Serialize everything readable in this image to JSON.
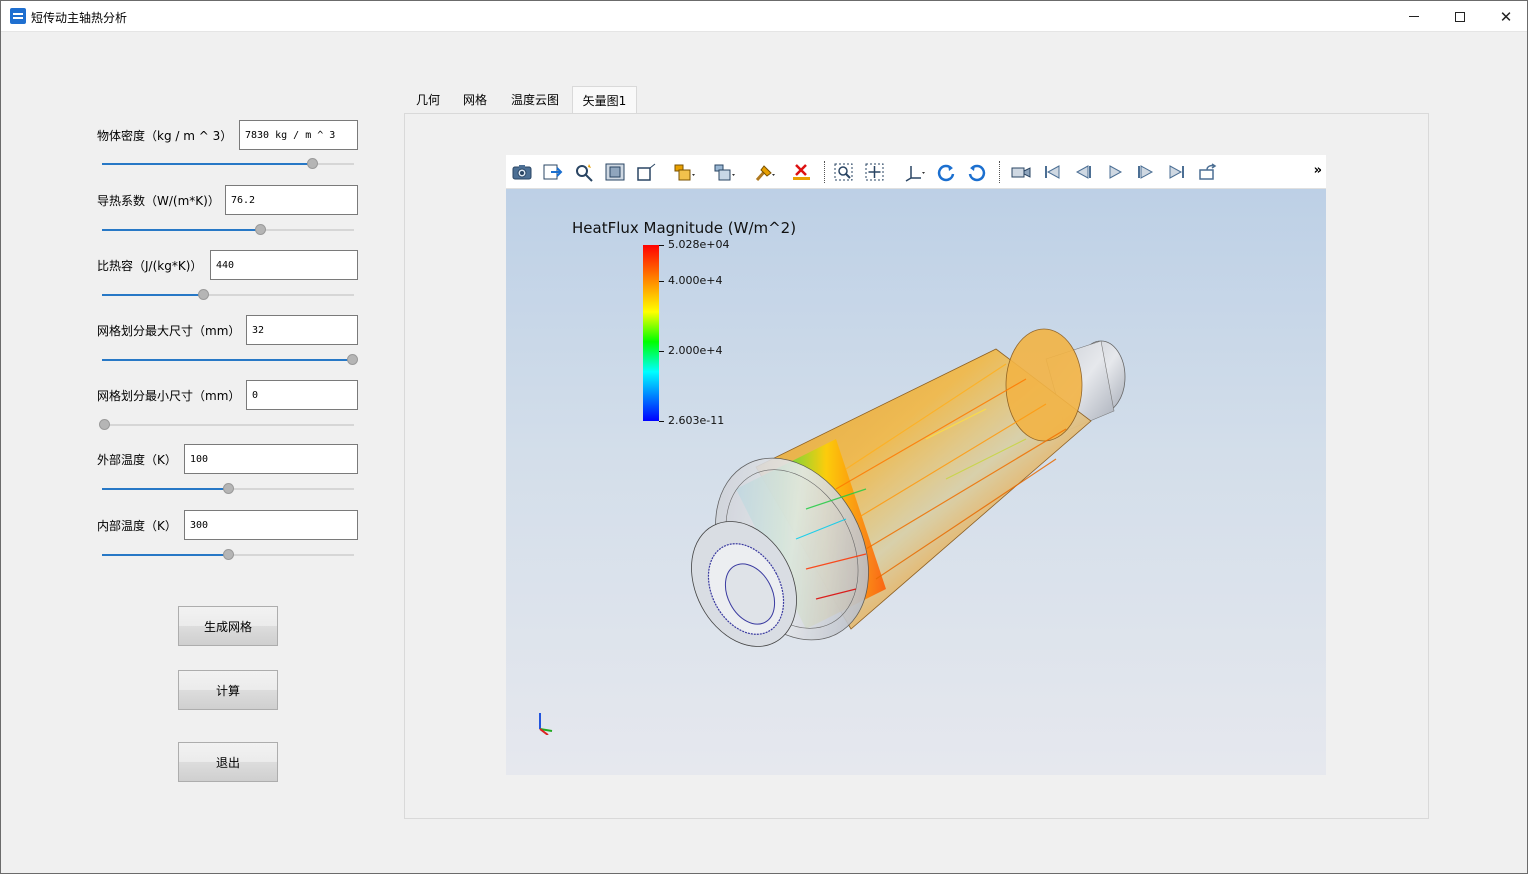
{
  "window": {
    "title": "短传动主轴热分析"
  },
  "params": [
    {
      "label": "物体密度（kg / m ^ 3）",
      "value": "7830 kg / m ^ 3",
      "slider": 0.84
    },
    {
      "label": "导热系数（W/(m*K)）",
      "value": "76.2",
      "slider": 0.63
    },
    {
      "label": "比热容（J/(kg*K)）",
      "value": "440",
      "slider": 0.4
    },
    {
      "label": "网格划分最大尺寸（mm）",
      "value": "32",
      "slider": 1.0
    },
    {
      "label": "网格划分最小尺寸（mm）",
      "value": "0",
      "slider": 0.0
    },
    {
      "label": "外部温度（K）",
      "value": "100",
      "slider": 0.5
    },
    {
      "label": "内部温度（K）",
      "value": "300",
      "slider": 0.5
    }
  ],
  "buttons": {
    "mesh": "生成网格",
    "compute": "计算",
    "exit": "退出"
  },
  "tabs": [
    {
      "label": "几何",
      "active": false
    },
    {
      "label": "网格",
      "active": false
    },
    {
      "label": "温度云图",
      "active": false
    },
    {
      "label": "矢量图1",
      "active": true
    }
  ],
  "toolbar": {
    "overflow": "»",
    "icons": [
      "camera-icon",
      "export-icon",
      "query-icon",
      "fit-icon",
      "box-icon",
      "display-mode-icon",
      "representation-icon",
      "paint-icon",
      "clear-icon",
      "zoom-region-icon",
      "pan-icon",
      "axes-orient-icon",
      "rotate-ccw-icon",
      "rotate-cw-icon",
      "record-icon",
      "first-frame-icon",
      "prev-frame-icon",
      "play-icon",
      "next-frame-icon",
      "last-frame-icon",
      "loop-icon"
    ]
  },
  "legend": {
    "title": "HeatFlux Magnitude (W/m^2)",
    "ticks": [
      "5.028e+04",
      "4.000e+4",
      "2.000e+4",
      "2.603e-11"
    ],
    "tick_values": [
      50280,
      40000,
      20000,
      0
    ],
    "max": 50280,
    "colors": [
      "#ff0000",
      "#ffff00",
      "#00ff00",
      "#00ffff",
      "#0000ff"
    ]
  }
}
